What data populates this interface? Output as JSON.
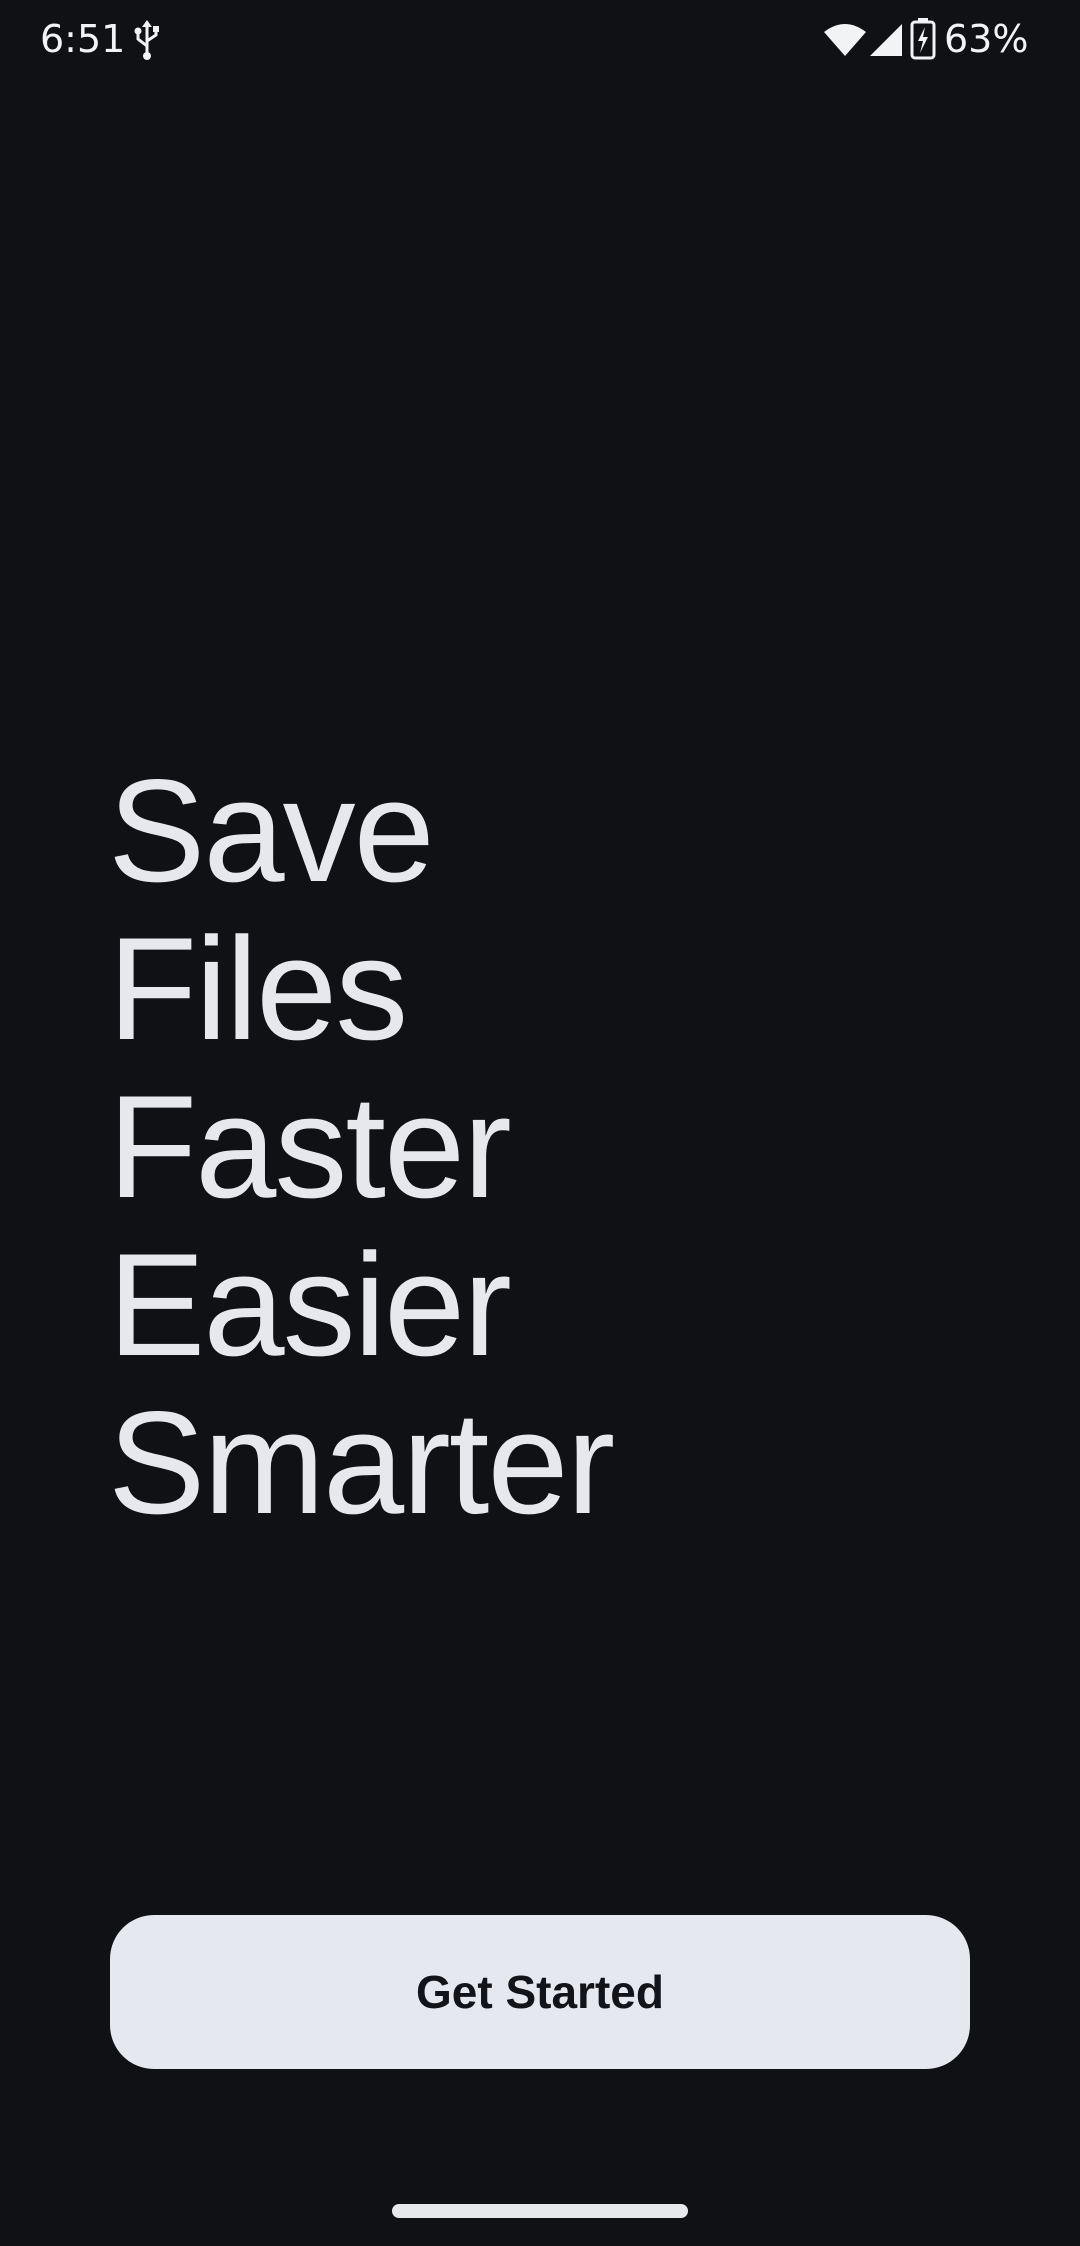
{
  "status_bar": {
    "time": "6:51",
    "battery_percent": "63%",
    "icons": [
      "usb-icon",
      "wifi-icon",
      "cell-signal-icon",
      "battery-charging-icon"
    ]
  },
  "hero": {
    "lines": [
      "Save",
      "Files",
      "Faster",
      "Easier",
      "Smarter"
    ]
  },
  "cta": {
    "label": "Get Started"
  },
  "colors": {
    "background": "#0f1115",
    "text": "#e6e8ee",
    "button_bg": "#e5e8ee",
    "button_text": "#12141a"
  }
}
